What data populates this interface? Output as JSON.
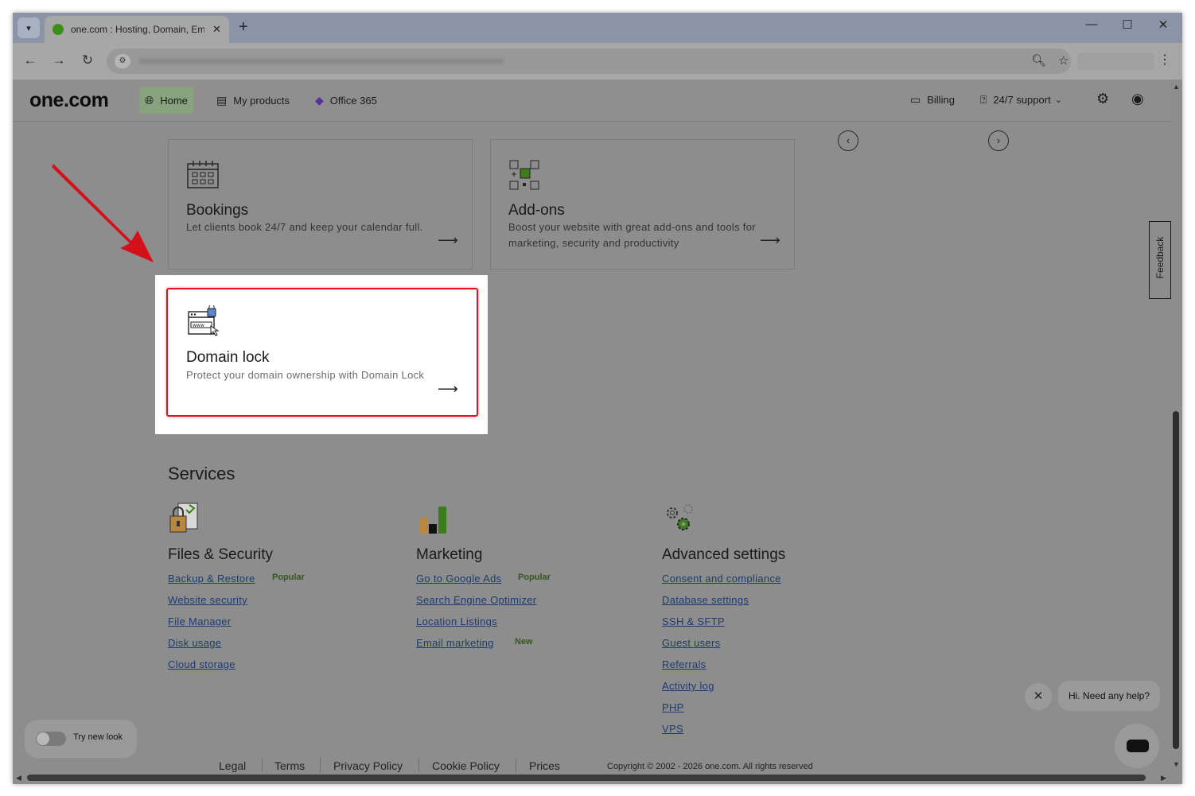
{
  "browser": {
    "tab_title": "one.com : Hosting, Domain, Em",
    "tab_close": "✕",
    "new_tab": "+",
    "minimize": "—",
    "maximize": "☐",
    "close": "✕"
  },
  "header": {
    "logo": "one.com",
    "nav": [
      {
        "label": "Home"
      },
      {
        "label": "My products"
      },
      {
        "label": "Office 365"
      }
    ],
    "billing": "Billing",
    "support": "24/7 support"
  },
  "cards": [
    {
      "title": "Bookings",
      "desc": "Let clients book 24/7 and keep your calendar full."
    },
    {
      "title": "Add-ons",
      "desc": "Boost your website with great add-ons and tools for marketing, security and productivity"
    }
  ],
  "highlight_card": {
    "title": "Domain lock",
    "desc": "Protect your domain ownership with Domain Lock"
  },
  "services": {
    "title": "Services",
    "columns": [
      {
        "title": "Files & Security",
        "links": [
          "Backup & Restore",
          "Website security",
          "File Manager",
          "Disk usage",
          "Cloud storage"
        ],
        "badge": "Popular"
      },
      {
        "title": "Marketing",
        "links": [
          "Go to Google Ads",
          "Search Engine Optimizer",
          "Location Listings",
          "Email marketing"
        ],
        "badge": "Popular",
        "badge2": "New"
      },
      {
        "title": "Advanced settings",
        "links": [
          "Consent and compliance",
          "Database settings",
          "SSH & SFTP",
          "Guest users",
          "Referrals",
          "Activity log",
          "PHP",
          "VPS"
        ]
      }
    ]
  },
  "feedback": "Feedback",
  "chat": {
    "bubble": "Hi. Need any help?"
  },
  "try_new_look": "Try new look",
  "footer": {
    "links": [
      "Legal",
      "Terms",
      "Privacy Policy",
      "Cookie Policy",
      "Prices"
    ],
    "copyright": "Copyright © 2002 - 2026 one.com. All rights reserved"
  }
}
